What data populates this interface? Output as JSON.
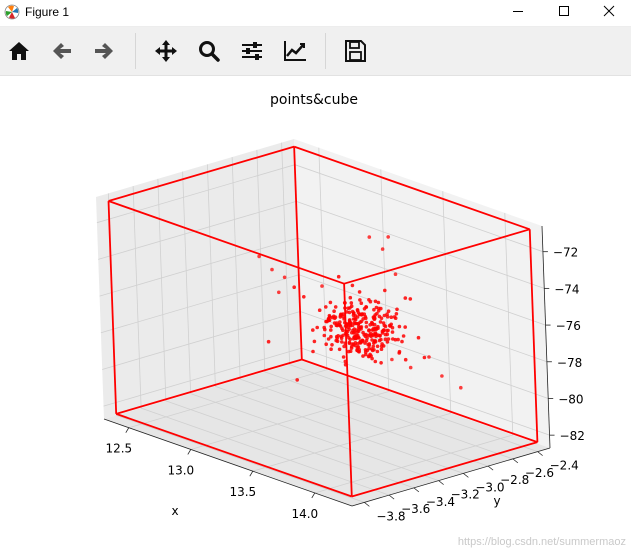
{
  "window": {
    "title": "Figure 1",
    "controls": [
      "minimize",
      "maximize",
      "close"
    ]
  },
  "toolbar": {
    "buttons": [
      {
        "name": "home",
        "icon": "home-icon"
      },
      {
        "name": "back",
        "icon": "arrow-left-icon"
      },
      {
        "name": "forward",
        "icon": "arrow-right-icon"
      },
      {
        "name": "pan",
        "icon": "move-icon"
      },
      {
        "name": "zoom",
        "icon": "search-icon"
      },
      {
        "name": "subplots",
        "icon": "sliders-icon"
      },
      {
        "name": "edit-axes",
        "icon": "line-chart-icon"
      },
      {
        "name": "save",
        "icon": "save-icon"
      }
    ]
  },
  "watermark": "https://blog.csdn.net/summermaoz",
  "chart_data": {
    "type": "scatter",
    "projection": "3d",
    "title": "points&cube",
    "xlabel": "x",
    "ylabel": "y",
    "zlabel": "",
    "xticks": [
      "12.5",
      "13.0",
      "13.5",
      "14.0"
    ],
    "yticks": [
      "−3.8",
      "−3.6",
      "−3.4",
      "−3.2",
      "−3.0",
      "−2.8",
      "−2.6",
      "−2.4"
    ],
    "zticks": [
      "−82",
      "−80",
      "−78",
      "−76",
      "−74",
      "−72"
    ],
    "xlim": [
      12.3,
      14.3
    ],
    "ylim": [
      -3.9,
      -2.3
    ],
    "zlim": [
      -82.7,
      -70.6
    ],
    "grid": true,
    "point_color": "#ff0000",
    "cube_color": "#ff0000",
    "cube": {
      "x": [
        12.35,
        14.25
      ],
      "y": [
        -3.85,
        -2.35
      ],
      "z": [
        -82.4,
        -70.8
      ]
    },
    "cluster": {
      "center": [
        13.45,
        -2.95,
        -76.9
      ],
      "spread": [
        0.12,
        0.12,
        0.75
      ],
      "count": 320
    },
    "outliers": [
      [
        12.9,
        -3.2,
        -73.8
      ],
      [
        12.95,
        -3.15,
        -74.5
      ],
      [
        13.05,
        -3.2,
        -75.4
      ],
      [
        13.2,
        -3.0,
        -75.1
      ],
      [
        13.4,
        -2.7,
        -73.2
      ],
      [
        13.55,
        -2.95,
        -71.7
      ],
      [
        13.5,
        -2.75,
        -72.2
      ],
      [
        13.6,
        -2.8,
        -73.9
      ],
      [
        13.75,
        -3.0,
        -77.8
      ],
      [
        13.85,
        -2.95,
        -78.1
      ],
      [
        13.9,
        -2.85,
        -77.6
      ],
      [
        14.0,
        -2.85,
        -78.4
      ],
      [
        14.1,
        -2.8,
        -78.9
      ],
      [
        13.2,
        -2.6,
        -78.2
      ],
      [
        13.0,
        -3.1,
        -74.9
      ]
    ]
  }
}
